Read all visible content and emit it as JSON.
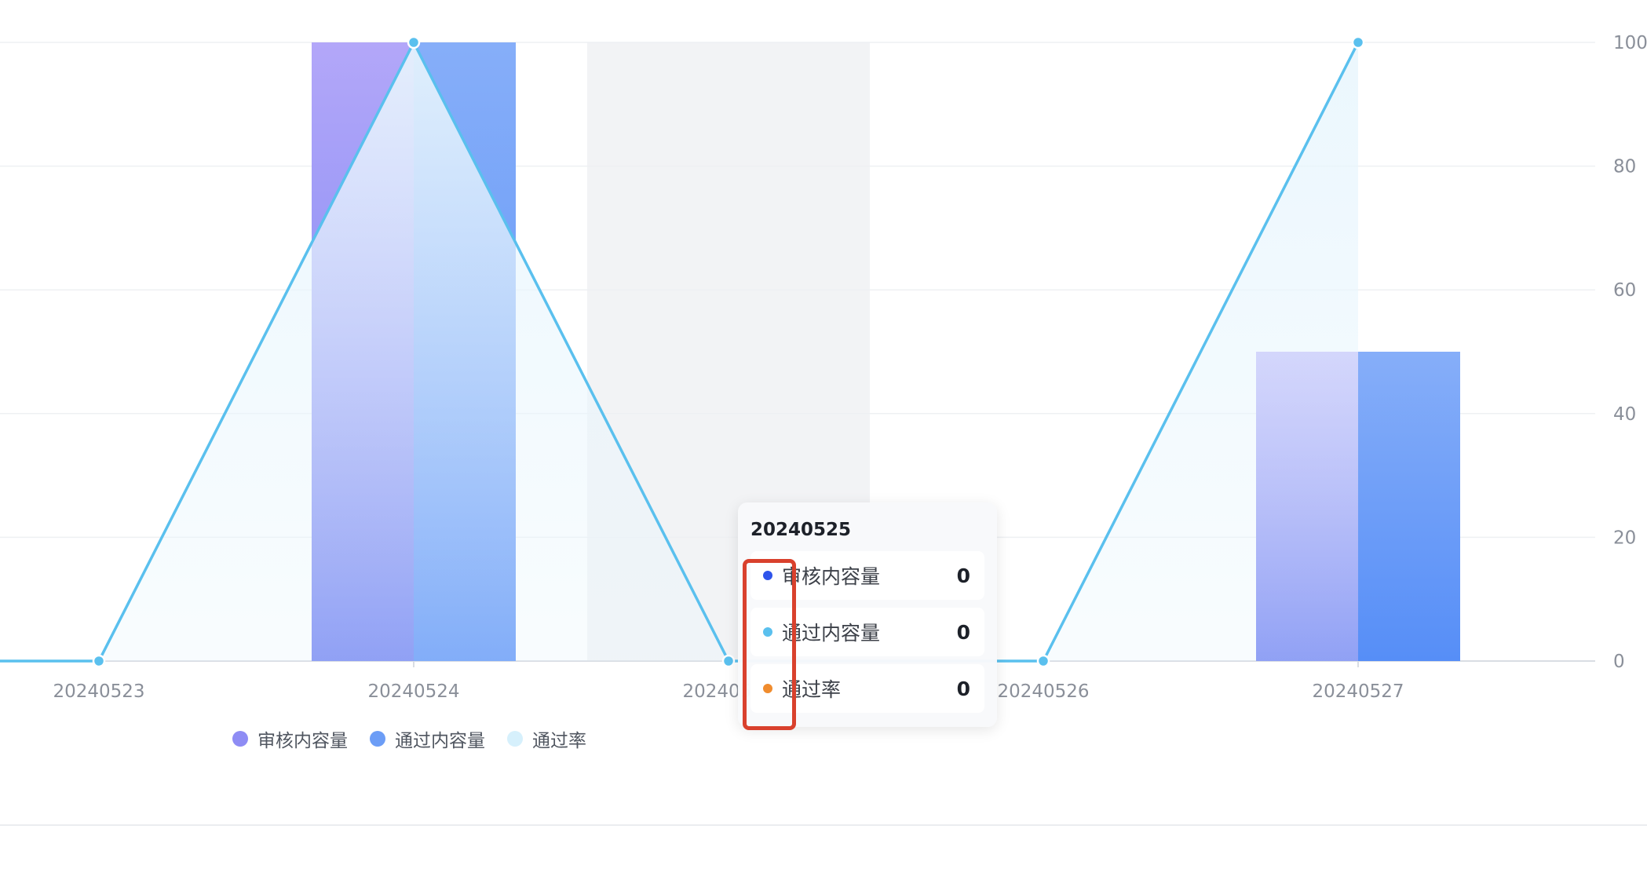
{
  "chart_data": {
    "type": "bar",
    "categories": [
      "20240523",
      "20240524",
      "20240525",
      "20240526",
      "20240527"
    ],
    "series": [
      {
        "name": "审核内容量",
        "type": "bar",
        "values": [
          0,
          100,
          0,
          0,
          50
        ]
      },
      {
        "name": "通过内容量",
        "type": "bar",
        "values": [
          0,
          100,
          0,
          0,
          50
        ]
      },
      {
        "name": "通过率",
        "type": "area-line",
        "values": [
          0,
          100,
          0,
          0,
          100
        ]
      }
    ],
    "ylim": [
      0,
      100
    ],
    "yticks": [
      0,
      20,
      40,
      60,
      80,
      100
    ],
    "y_axis_side": "right",
    "grid": true,
    "legend_position": "bottom-left",
    "highlighted_category": "20240525"
  },
  "colors": {
    "bar1_top": "#b3a7f9",
    "bar1_bottom": "#6a7cf1",
    "bar2_top": "#86aef9",
    "bar2_bottom": "#568ef7",
    "line": "#5ac0ee",
    "area": "#e9f6fd",
    "grid": "#eef0f3",
    "axis": "#d9dde3",
    "hover_band": "#f2f3f5",
    "tooltip_dot_1": "#2f54eb",
    "tooltip_dot_2": "#5ac0ee",
    "tooltip_dot_3": "#f08c2e",
    "legend_dot_1": "#8e8cf4",
    "legend_dot_2": "#6c9df6",
    "legend_dot_3": "#d6f0fc",
    "highlight_box": "#d9412d"
  },
  "legend": [
    {
      "label": "审核内容量",
      "color_key": "legend_dot_1"
    },
    {
      "label": "通过内容量",
      "color_key": "legend_dot_2"
    },
    {
      "label": "通过率",
      "color_key": "legend_dot_3"
    }
  ],
  "tooltip": {
    "title": "20240525",
    "rows": [
      {
        "name": "审核内容量",
        "value": "0",
        "color_key": "tooltip_dot_1"
      },
      {
        "name": "通过内容量",
        "value": "0",
        "color_key": "tooltip_dot_2"
      },
      {
        "name": "通过率",
        "value": "0",
        "color_key": "tooltip_dot_3"
      }
    ]
  }
}
